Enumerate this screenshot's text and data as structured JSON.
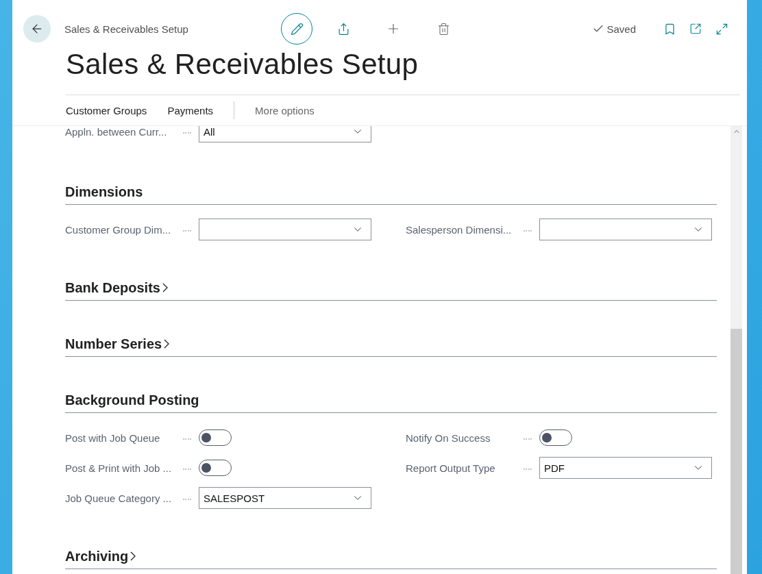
{
  "header": {
    "breadcrumb": "Sales & Receivables Setup",
    "status": "Saved",
    "title": "Sales & Receivables Setup"
  },
  "actions": [
    {
      "label": "Customer Groups",
      "kind": "action"
    },
    {
      "label": "Payments",
      "kind": "action"
    },
    {
      "label": "More options",
      "kind": "more"
    }
  ],
  "top_fields": [
    {
      "label": "Appln. between Curr...",
      "kind": "select",
      "value": "All"
    }
  ],
  "sections": [
    {
      "title": "Dimensions",
      "expanded": true,
      "fields": [
        {
          "label": "Customer Group Dim...",
          "kind": "select"
        },
        {
          "label": "Salesperson Dimensi...",
          "kind": "select"
        }
      ]
    },
    {
      "title": "Bank Deposits",
      "expanded": false
    },
    {
      "title": "Number Series",
      "expanded": false
    },
    {
      "title": "Background Posting",
      "expanded": true,
      "fields": [
        {
          "label": "Post with Job Queue",
          "kind": "toggle",
          "on": false
        },
        {
          "label": "Notify On Success",
          "kind": "toggle",
          "on": false
        },
        {
          "label": "Post & Print with Job ...",
          "kind": "toggle",
          "on": false
        },
        {
          "label": "Report Output Type",
          "kind": "select",
          "value": "PDF"
        },
        {
          "label": "Job Queue Category ...",
          "kind": "select",
          "value": "SALESPOST"
        }
      ]
    },
    {
      "title": "Archiving",
      "expanded": false
    }
  ]
}
